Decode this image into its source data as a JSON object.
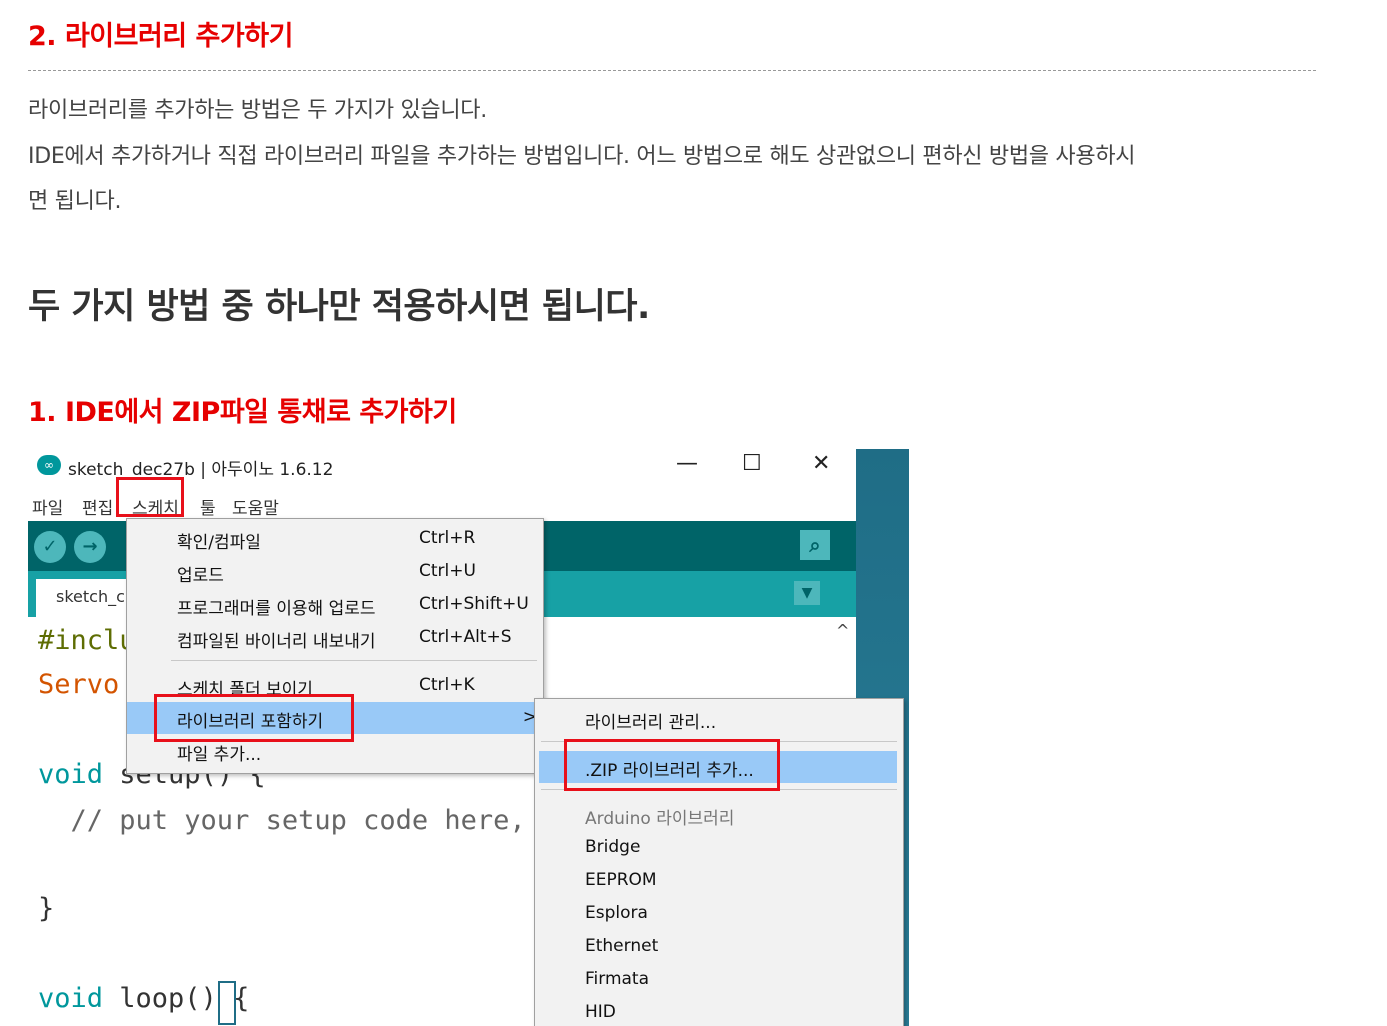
{
  "section2_heading": "2. 라이브러리 추가하기",
  "intro_line1": "라이브러리를 추가하는 방법은 두 가지가 있습니다.",
  "intro_line2": "IDE에서 추가하거나 직접 라이브러리 파일을 추가하는 방법입니다. 어느 방법으로 해도 상관없으니 편하신 방법을 사용하시",
  "intro_line3": "면 됩니다.",
  "emphasis": "두 가지 방법 중 하나만 적용하시면 됩니다.",
  "section1_heading": "1. IDE에서 ZIP파일 통채로 추가하기",
  "ide": {
    "window_title": "sketch_dec27b | 아두이노 1.6.12",
    "logo_glyph": "∞",
    "min_glyph": "—",
    "max_glyph": "☐",
    "close_glyph": "✕",
    "menus": {
      "file": "파일",
      "edit": "편집",
      "sketch": "스케치",
      "tools": "툴",
      "help": "도움말"
    },
    "verify_glyph": "✓",
    "upload_glyph": "→",
    "monitor_glyph": "⌕",
    "tab_dropdown_glyph": "▼",
    "scroll_up_glyph": "^",
    "tab_label": "sketch_c",
    "code": {
      "line1": "#inclu",
      "line2": "Servo",
      "line3_kw": "void",
      "line3_rest": " setup() {",
      "line4": "  // put your setup code here, to",
      "line5": "}",
      "line6_kw": "void",
      "line6_rest": " loop() {"
    },
    "sketch_menu": [
      {
        "label": "확인/컴파일",
        "shortcut": "Ctrl+R"
      },
      {
        "label": "업로드",
        "shortcut": "Ctrl+U"
      },
      {
        "label": "프로그래머를 이용해 업로드",
        "shortcut": "Ctrl+Shift+U"
      },
      {
        "label": "컴파일된 바이너리 내보내기",
        "shortcut": "Ctrl+Alt+S"
      },
      {
        "label": "스케치 폴더 보이기",
        "shortcut": "Ctrl+K"
      },
      {
        "label": "라이브러리 포함하기",
        "shortcut": "",
        "arrow": ">"
      },
      {
        "label": "파일 추가...",
        "shortcut": ""
      }
    ],
    "library_submenu": {
      "manage": "라이브러리 관리...",
      "add_zip": ".ZIP 라이브러리 추가...",
      "section_header": "Arduino 라이브러리",
      "items": [
        "Bridge",
        "EEPROM",
        "Esplora",
        "Ethernet",
        "Firmata",
        "HID"
      ]
    }
  }
}
